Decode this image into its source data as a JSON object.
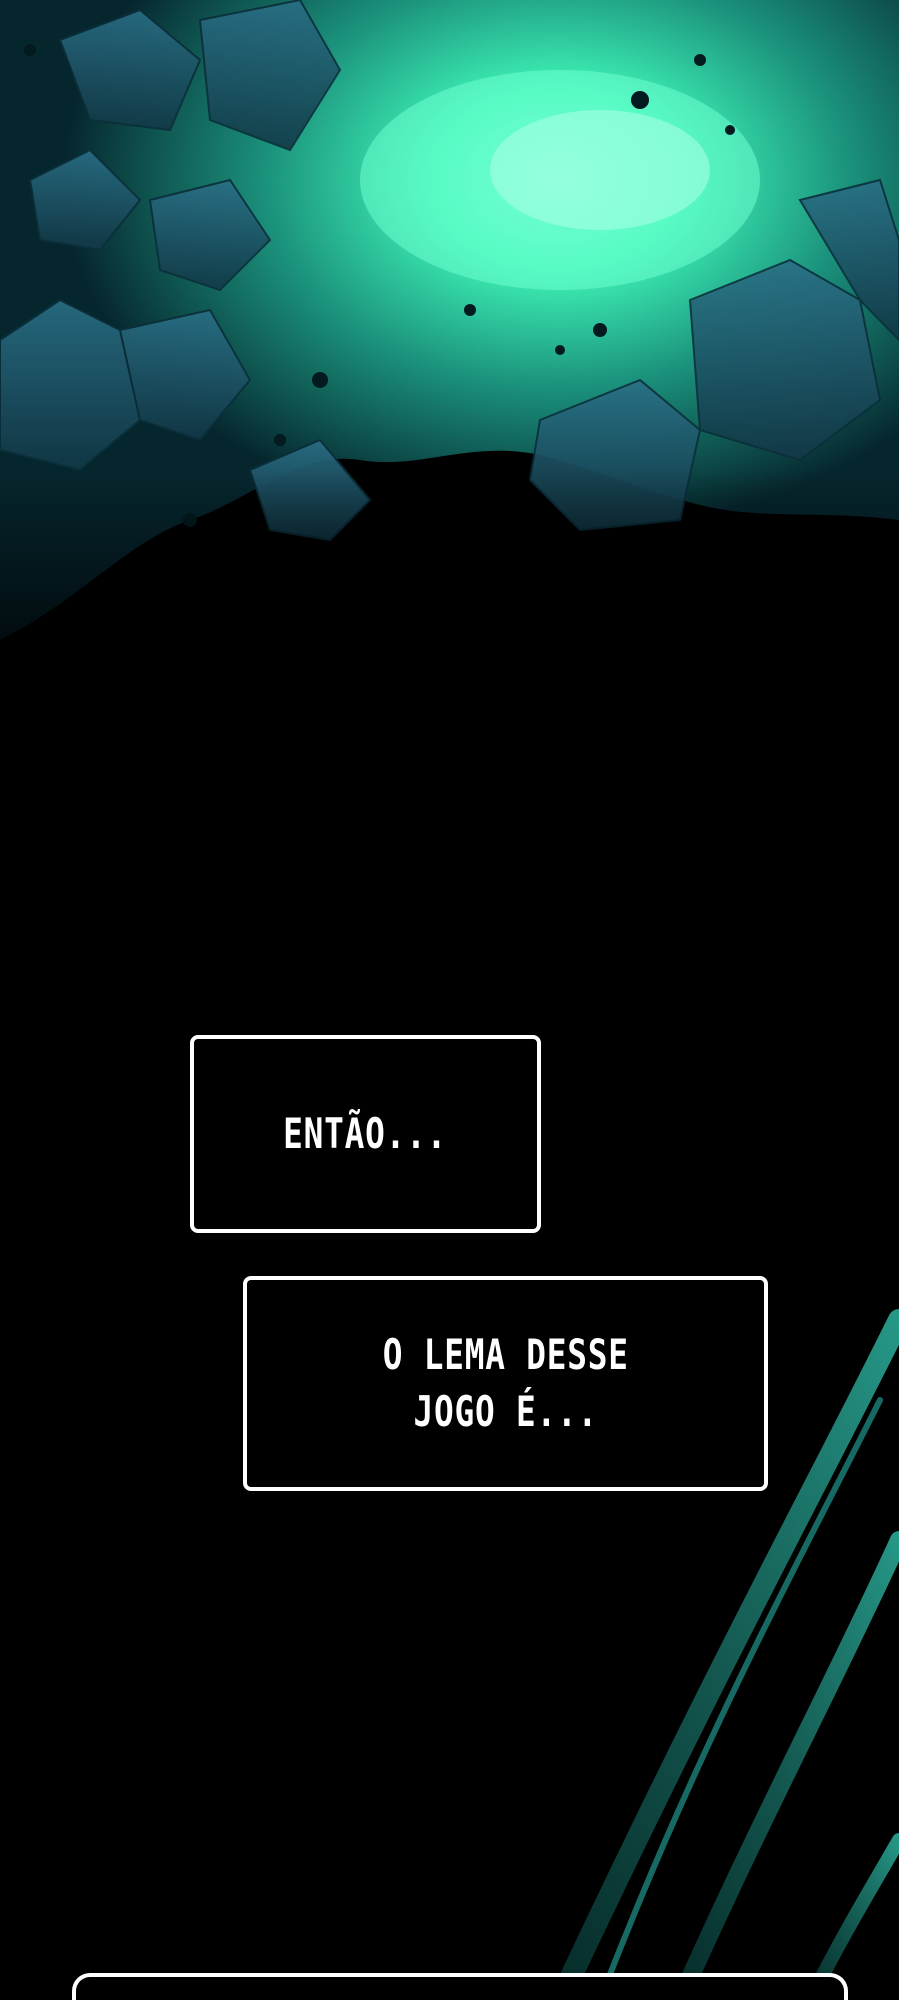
{
  "panel": {
    "theme_colors": {
      "glow": "#3ff5b8",
      "teal": "#1f8a8a",
      "deep": "#0b3a4a",
      "background": "#000000",
      "caption_border": "#ffffff",
      "caption_text": "#ffffff"
    }
  },
  "captions": [
    {
      "text": "ENTÃO..."
    },
    {
      "text": "O LEMA DESSE\nJOGO É..."
    },
    {
      "text": ""
    }
  ]
}
